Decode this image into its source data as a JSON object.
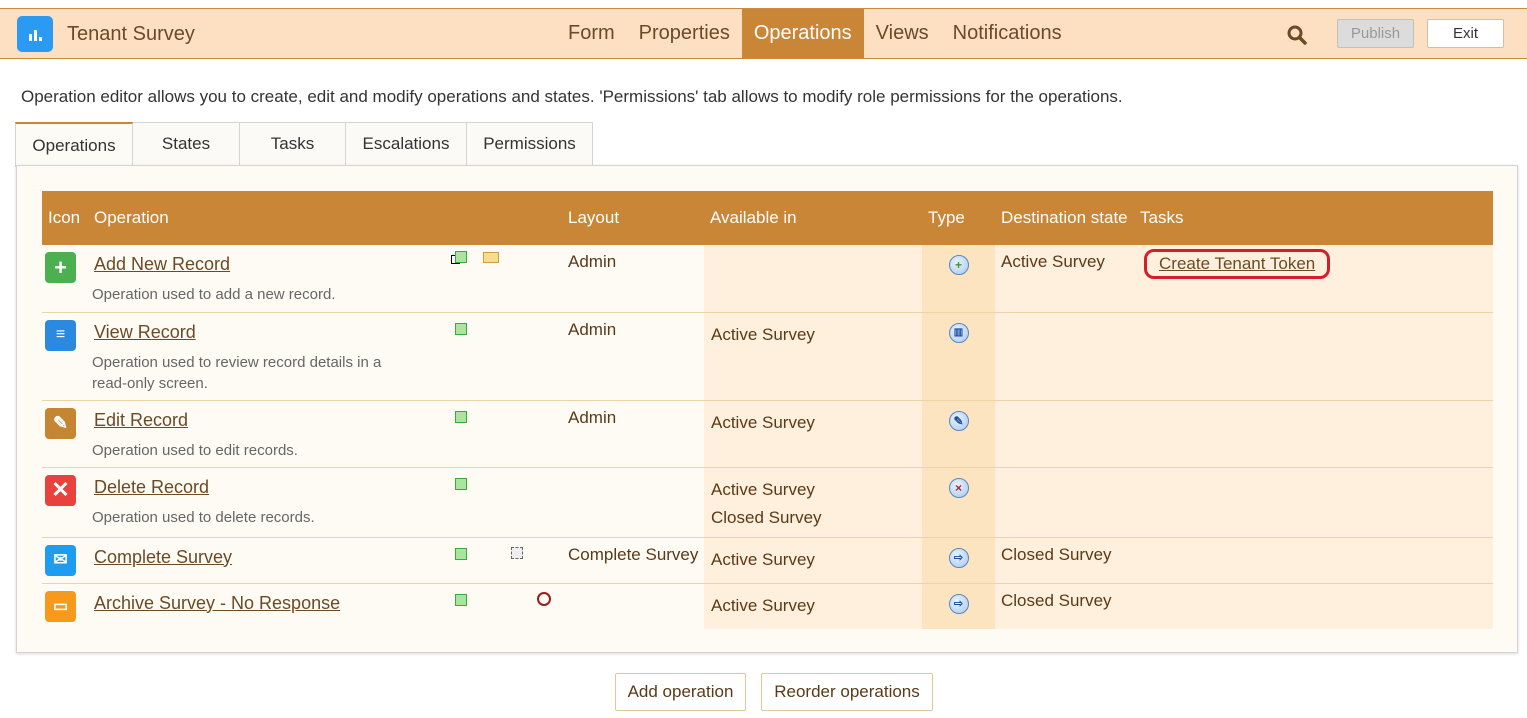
{
  "app": {
    "title": "Tenant Survey",
    "icon": "bar-chart-icon"
  },
  "nav": {
    "items": [
      {
        "label": "Form",
        "active": false
      },
      {
        "label": "Properties",
        "active": false
      },
      {
        "label": "Operations",
        "active": true
      },
      {
        "label": "Views",
        "active": false
      },
      {
        "label": "Notifications",
        "active": false
      }
    ],
    "publish_label": "Publish",
    "exit_label": "Exit"
  },
  "intro": "Operation editor allows you to create, edit and modify operations and states. 'Permissions' tab allows to modify role permissions for the operations.",
  "tabs": [
    {
      "label": "Operations",
      "active": true
    },
    {
      "label": "States",
      "active": false
    },
    {
      "label": "Tasks",
      "active": false
    },
    {
      "label": "Escalations",
      "active": false
    },
    {
      "label": "Permissions",
      "active": false
    }
  ],
  "table": {
    "headers": {
      "icon": "Icon",
      "operation": "Operation",
      "layout": "Layout",
      "available": "Available in",
      "type": "Type",
      "destination": "Destination state",
      "tasks": "Tasks"
    },
    "rows": [
      {
        "name": "Add New Record",
        "desc": "Operation used to add a new record.",
        "icon": "plus-icon",
        "icon_color": "#4caf50",
        "layout": "Admin",
        "available": [],
        "type": "create-type-icon",
        "destination": "Active Survey",
        "task": "Create Tenant Token",
        "extras": [
          "green-flag",
          "subform-marker-icon",
          "envelope-icon"
        ]
      },
      {
        "name": "View Record",
        "desc": "Operation used to review record details in a read-only screen.",
        "icon": "document-icon",
        "icon_color": "#2b8ae0",
        "layout": "Admin",
        "available": [
          "Active Survey"
        ],
        "type": "view-type-icon",
        "destination": "",
        "task": "",
        "extras": [
          "green-flag"
        ]
      },
      {
        "name": "Edit Record",
        "desc": "Operation used to edit records.",
        "icon": "edit-icon",
        "icon_color": "#c58634",
        "layout": "Admin",
        "available": [
          "Active Survey"
        ],
        "type": "edit-type-icon",
        "destination": "",
        "task": "",
        "extras": [
          "green-flag"
        ]
      },
      {
        "name": "Delete Record",
        "desc": "Operation used to delete records.",
        "icon": "close-icon",
        "icon_color": "#e9413c",
        "layout": "",
        "available": [
          "Active Survey",
          "Closed Survey"
        ],
        "type": "delete-type-icon",
        "destination": "",
        "task": "",
        "extras": [
          "green-flag"
        ]
      },
      {
        "name": "Complete Survey",
        "desc": "",
        "icon": "envelope-icon",
        "icon_color": "#1e9cf0",
        "layout": "Complete Survey",
        "available": [
          "Active Survey"
        ],
        "type": "transition-type-icon",
        "destination": "Closed Survey",
        "task": "",
        "extras": [
          "green-flag",
          "fullscreen-icon"
        ]
      },
      {
        "name": "Archive Survey - No Response",
        "desc": "",
        "icon": "archive-icon",
        "icon_color": "#f79a1c",
        "layout": "",
        "available": [
          "Active Survey"
        ],
        "type": "transition-type-icon",
        "destination": "Closed Survey",
        "task": "",
        "extras": [
          "green-flag",
          "clock-icon"
        ]
      }
    ]
  },
  "buttons": {
    "add": "Add operation",
    "reorder": "Reorder operations"
  }
}
